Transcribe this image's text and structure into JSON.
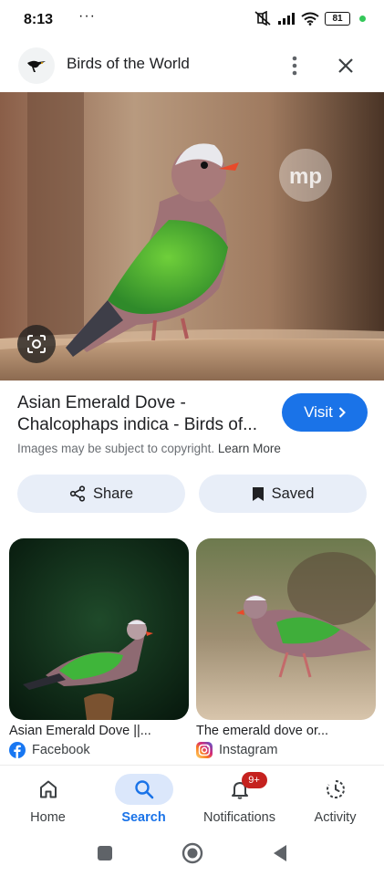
{
  "status_bar": {
    "time": "8:13",
    "dots": "···",
    "battery": "81"
  },
  "header": {
    "title": "Birds of the World"
  },
  "result": {
    "title_line1": "Asian Emerald Dove -",
    "title_line2": "Chalcophaps indica - Birds of...",
    "visit_label": "Visit",
    "copyright_text": "Images may be subject to copyright.",
    "learn_more": "Learn More",
    "watermark": "mp"
  },
  "actions": {
    "share_label": "Share",
    "saved_label": "Saved"
  },
  "related": [
    {
      "title": "Asian Emerald Dove ||...",
      "source": "Facebook"
    },
    {
      "title": "The emerald dove or...",
      "source": "Instagram"
    }
  ],
  "bottom_nav": [
    {
      "label": "Home",
      "icon": "home-icon"
    },
    {
      "label": "Search",
      "icon": "search-icon",
      "active": true
    },
    {
      "label": "Notifications",
      "icon": "bell-icon",
      "badge": "9+"
    },
    {
      "label": "Activity",
      "icon": "activity-icon"
    }
  ],
  "colors": {
    "accent": "#1a73e8",
    "pill_bg": "#e8eef8",
    "badge": "#c5221f"
  }
}
